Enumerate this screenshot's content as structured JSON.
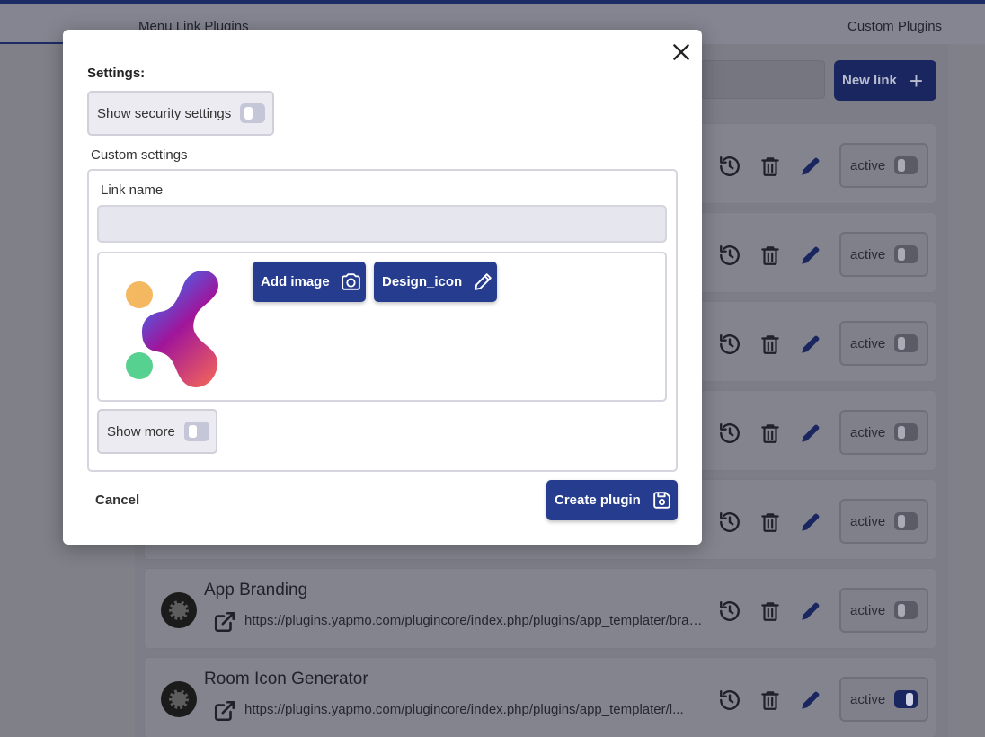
{
  "tabs": {
    "menu_link_plugins": "Menu Link Plugins",
    "custom_plugins": "Custom Plugins"
  },
  "toolbar": {
    "new_link_label": "New link",
    "new_link_icon": "plus-icon"
  },
  "plugin_rows": [
    {
      "title": "",
      "url": "",
      "status_label": "active",
      "active": false
    },
    {
      "title": "",
      "url": "",
      "status_label": "active",
      "active": false
    },
    {
      "title": "",
      "url": "",
      "status_label": "active",
      "active": false
    },
    {
      "title": "",
      "url": "",
      "status_label": "active",
      "active": false
    },
    {
      "title": "",
      "url": "",
      "status_label": "active",
      "active": false
    },
    {
      "title": "App Branding",
      "url": "https://plugins.yapmo.com/plugincore/index.php/plugins/app_templater/branding",
      "status_label": "active",
      "active": false
    },
    {
      "title": "Room Icon Generator",
      "url": "https://plugins.yapmo.com/plugincore/index.php/plugins/app_templater/l...",
      "status_label": "active",
      "active": true
    }
  ],
  "modal": {
    "settings_label": "Settings:",
    "security_toggle_label": "Show security settings",
    "custom_settings_label": "Custom settings",
    "link_name_label": "Link name",
    "link_name_value": "",
    "add_image_label": "Add image",
    "design_icon_label": "Design_icon",
    "show_more_label": "Show more",
    "cancel_label": "Cancel",
    "create_label": "Create plugin"
  },
  "colors": {
    "primary": "#263c8f",
    "primary_dark": "#1d2c66",
    "overlay": "#7f8088",
    "logo_orange": "#f4b860",
    "logo_green": "#57d18f"
  }
}
